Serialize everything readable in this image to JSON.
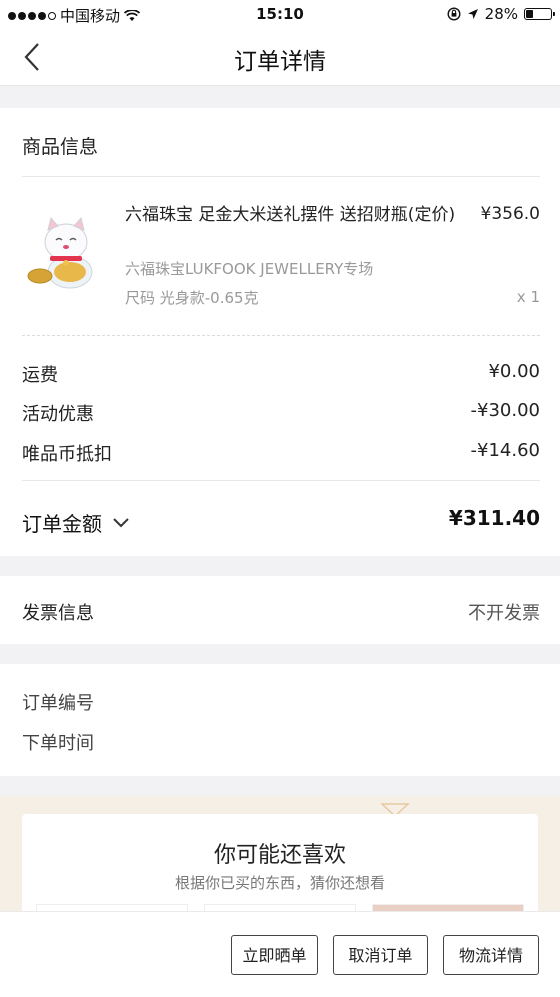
{
  "status_bar": {
    "carrier": "中国移动",
    "time": "15:10",
    "battery": "28%",
    "battery_level": 0.28
  },
  "nav": {
    "title": "订单详情"
  },
  "goods": {
    "section_title": "商品信息",
    "product": {
      "name": "六福珠宝 足金大米送礼摆件 送招财瓶(定价)",
      "price": "¥356.0",
      "store": "六福珠宝LUKFOOK JEWELLERY专场",
      "spec": "尺码  光身款-0.65克",
      "qty": "x 1"
    }
  },
  "fees": [
    {
      "label": "运费",
      "value": "¥0.00"
    },
    {
      "label": "活动优惠",
      "value": "-¥30.00"
    },
    {
      "label": "唯品币抵扣",
      "value": "-¥14.60"
    }
  ],
  "total": {
    "label": "订单金额",
    "value": "¥311.40"
  },
  "invoice": {
    "label": "发票信息",
    "value": "不开发票"
  },
  "order": {
    "number_label": "订单编号",
    "time_label": "下单时间"
  },
  "recommend": {
    "title": "你可能还喜欢",
    "subtitle": "根据你已买的东西，猜你还想看"
  },
  "actions": {
    "share": "立即晒单",
    "cancel": "取消订单",
    "logistics": "物流详情"
  }
}
